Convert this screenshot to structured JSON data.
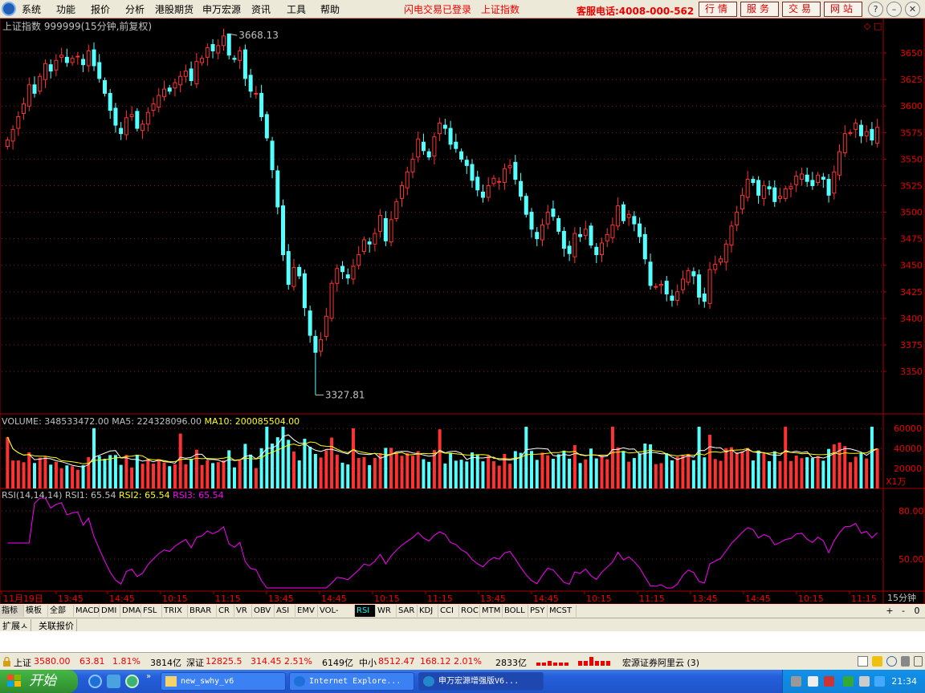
{
  "menu": {
    "items": [
      "系统",
      "功能",
      "报价",
      "分析",
      "港股期货",
      "申万宏源",
      "资讯",
      "工具",
      "帮助"
    ],
    "login": "闪电交易已登录",
    "index_link": "上证指数",
    "phone": "客服电话:4008-000-562",
    "top_buttons": [
      "行情",
      "服务",
      "交易",
      "网站"
    ]
  },
  "header": {
    "title": "上证指数 999999(15分钟,前复权)",
    "high_label": "3668.13",
    "low_label": "3327.81"
  },
  "price_axis": {
    "ticks": [
      "3650",
      "3625",
      "3600",
      "3575",
      "3550",
      "3525",
      "3500",
      "3475",
      "3450",
      "3425",
      "3400",
      "3375",
      "3350"
    ]
  },
  "volume": {
    "label": "VOLUME:",
    "value": "348533472.00",
    "ma5_label": "MA5:",
    "ma5": "224328096.00",
    "ma10_label": "MA10:",
    "ma10": "200085504.00",
    "ticks": [
      "60000",
      "40000",
      "20000"
    ],
    "unit": "X1万"
  },
  "rsi": {
    "label": "RSI(14,14,14)",
    "rsi1": "RSI1: 65.54",
    "rsi2": "RSI2: 65.54",
    "rsi3": "RSI3: 65.54",
    "ticks": [
      "80.00",
      "50.00"
    ]
  },
  "time_axis": {
    "labels": [
      "11月19日",
      "13:45",
      "14:45",
      "10:15",
      "11:15",
      "13:45",
      "14:45",
      "10:15",
      "11:15",
      "13:45",
      "14:45",
      "10:15",
      "11:15",
      "13:45",
      "14:45",
      "10:15",
      "11:15"
    ],
    "period": "15分钟"
  },
  "tabs": [
    "指标",
    "模板",
    "全部",
    "MACD",
    "DMI",
    "DMA",
    "FSL",
    "TRIX",
    "BRAR",
    "CR",
    "VR",
    "OBV",
    "ASI",
    "EMV",
    "VOL-TDX",
    "RSI",
    "WR",
    "SAR",
    "KDJ",
    "CCI",
    "ROC",
    "MTM",
    "BOLL",
    "PSY",
    "MCST"
  ],
  "tab_controls": [
    "+",
    "-",
    "0"
  ],
  "ext_tabs": [
    "扩展ㅅ",
    "关联报价"
  ],
  "status": {
    "sh_name": "上证",
    "sh_val": "3580.00",
    "sh_chg": "63.81",
    "sh_pct": "1.81%",
    "sh_amt": "3814亿",
    "sz_name": "深证",
    "sz_val": "12825.5",
    "sz_chg": "314.45",
    "sz_pct": "2.51%",
    "sz_amt": "6149亿",
    "zx_name": "中小",
    "zx_val": "8512.47",
    "zx_chg": "168.12",
    "zx_pct": "2.01%",
    "zx_amt": "2833亿",
    "broker": "宏源证券阿里云 (3)"
  },
  "taskbar": {
    "start": "开始",
    "tasks": [
      "new_swhy_v6",
      "Internet Explore...",
      "申万宏源增强版V6..."
    ],
    "clock": "21:34"
  },
  "chart_data": {
    "type": "candlestick",
    "title": "上证指数 999999(15分钟,前复权)",
    "ylim": [
      3310,
      3675
    ],
    "high": 3668.13,
    "low": 3327.81,
    "close": [
      3568,
      3578,
      3590,
      3602,
      3620,
      3612,
      3628,
      3640,
      3633,
      3643,
      3648,
      3641,
      3645,
      3647,
      3639,
      3652,
      3638,
      3626,
      3612,
      3596,
      3582,
      3574,
      3589,
      3592,
      3579,
      3583,
      3594,
      3602,
      3610,
      3616,
      3614,
      3622,
      3628,
      3633,
      3624,
      3642,
      3645,
      3655,
      3652,
      3657,
      3666,
      3648,
      3644,
      3652,
      3626,
      3614,
      3612,
      3590,
      3570,
      3540,
      3505,
      3460,
      3432,
      3448,
      3440,
      3410,
      3384,
      3368,
      3380,
      3402,
      3433,
      3447,
      3444,
      3438,
      3449,
      3460,
      3474,
      3470,
      3480,
      3497,
      3473,
      3493,
      3510,
      3525,
      3538,
      3550,
      3569,
      3558,
      3552,
      3571,
      3584,
      3579,
      3564,
      3560,
      3550,
      3544,
      3530,
      3521,
      3514,
      3525,
      3532,
      3529,
      3541,
      3544,
      3531,
      3515,
      3498,
      3484,
      3475,
      3488,
      3500,
      3496,
      3482,
      3466,
      3461,
      3480,
      3477,
      3484,
      3469,
      3460,
      3471,
      3479,
      3488,
      3506,
      3492,
      3498,
      3489,
      3477,
      3456,
      3431,
      3430,
      3432,
      3423,
      3417,
      3425,
      3437,
      3445,
      3440,
      3420,
      3416,
      3446,
      3451,
      3456,
      3470,
      3487,
      3500,
      3516,
      3531,
      3528,
      3516,
      3525,
      3522,
      3510,
      3515,
      3522,
      3524,
      3534,
      3536,
      3529,
      3525,
      3535,
      3531,
      3516,
      3538,
      3557,
      3574,
      3575,
      3584,
      3572,
      3576,
      3568,
      3580
    ],
    "volume_max": 65000
  }
}
